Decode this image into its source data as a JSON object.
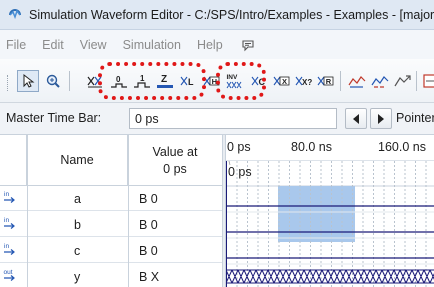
{
  "window": {
    "title": "Simulation Waveform Editor - C:/SPS/Intro/Examples - Examples - [majorit"
  },
  "menu": [
    "File",
    "Edit",
    "View",
    "Simulation",
    "Help"
  ],
  "toolbar": {
    "buttons": [
      {
        "name": "selection-tool",
        "glyph": "pointer-icon"
      },
      {
        "name": "zoom-tool",
        "glyph": "zoom-icon"
      },
      {
        "name": "uninitialized",
        "glyph": "uninitialized-icon"
      },
      {
        "name": "forcing-low",
        "label": "0"
      },
      {
        "name": "forcing-high",
        "label": "1"
      },
      {
        "name": "high-impedance",
        "label": "Z"
      },
      {
        "name": "weak-low",
        "label": "L"
      },
      {
        "name": "weak-high",
        "label": "H"
      },
      {
        "name": "invert",
        "label": "INV"
      },
      {
        "name": "count-value",
        "label": "C"
      },
      {
        "name": "overwrite-clock",
        "label": "X"
      },
      {
        "name": "dont-care",
        "label": "X?"
      },
      {
        "name": "random-values",
        "label": "R"
      }
    ]
  },
  "master_time_bar": {
    "label": "Master Time Bar:",
    "value": "0 ps",
    "pointer_label": "Pointer"
  },
  "grid": {
    "col_name": "Name",
    "col_value_line1": "Value at",
    "col_value_line2": "0 ps"
  },
  "signals": [
    {
      "dir": "in",
      "name": "a",
      "value": "B 0"
    },
    {
      "dir": "in",
      "name": "b",
      "value": "B 0"
    },
    {
      "dir": "in",
      "name": "c",
      "value": "B 0"
    },
    {
      "dir": "out",
      "name": "y",
      "value": "B X"
    }
  ],
  "timeline": {
    "ticks": [
      "0 ps",
      "80.0 ns",
      "160.0 ns"
    ],
    "cursor_label": "0 ps"
  },
  "colors": {
    "selection_fill": "#a9c8ec",
    "callout": "#e01818",
    "wave": "#1a1a78"
  }
}
